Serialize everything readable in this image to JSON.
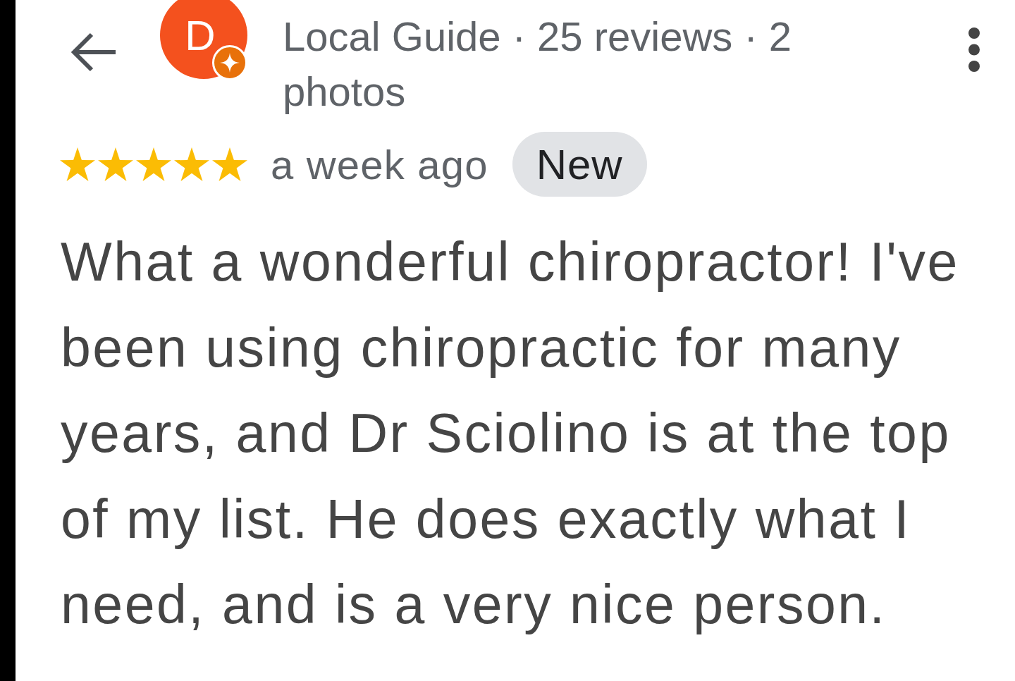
{
  "reviewer": {
    "avatar_initial": "D",
    "stats": "Local Guide · 25 reviews · 2 photos"
  },
  "review": {
    "stars": 5,
    "time": "a week ago",
    "badge": "New",
    "text": "What a wonderful chiropractor! I've been using chiropractic for many years, and Dr Sciolino is at the top of my list. He does exactly what I need, and is a very nice person."
  }
}
